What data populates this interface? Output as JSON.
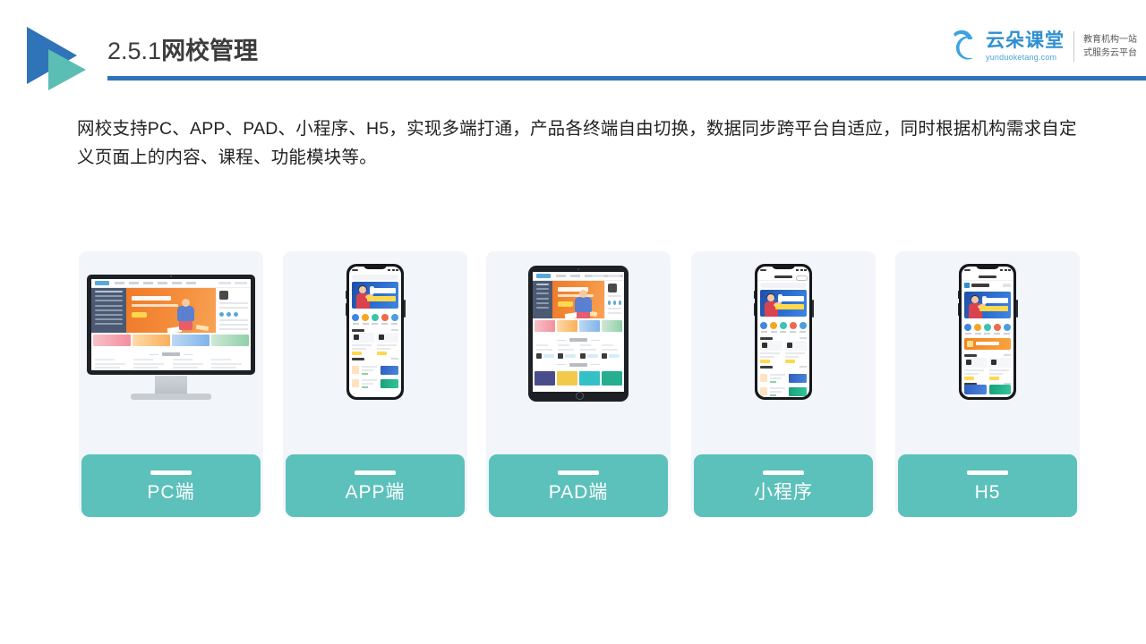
{
  "header": {
    "title_number": "2.5.1",
    "title_text": "网校管理",
    "logo_icon": "double-triangle-play-icon",
    "underline_color": "#2f73b8"
  },
  "brand": {
    "cloud_icon": "cloud-logo-icon",
    "name": "云朵课堂",
    "domain": "yunduoketang.com",
    "tagline_line1": "教育机构一站",
    "tagline_line2": "式服务云平台",
    "color": "#2f8fd0"
  },
  "intro": {
    "paragraph": "网校支持PC、APP、PAD、小程序、H5，实现多端打通，产品各终端自由切换，数据同步跨平台自适应，同时根据机构需求自定义页面上的内容、课程、功能模块等。"
  },
  "cards": {
    "accent_color": "#5cc0bb",
    "background_color": "#f2f5fa",
    "items": [
      {
        "label": "PC端",
        "device": "desktop-monitor"
      },
      {
        "label": "APP端",
        "device": "smartphone"
      },
      {
        "label": "PAD端",
        "device": "tablet"
      },
      {
        "label": "小程序",
        "device": "smartphone-miniprogram"
      },
      {
        "label": "H5",
        "device": "smartphone-h5"
      }
    ]
  }
}
